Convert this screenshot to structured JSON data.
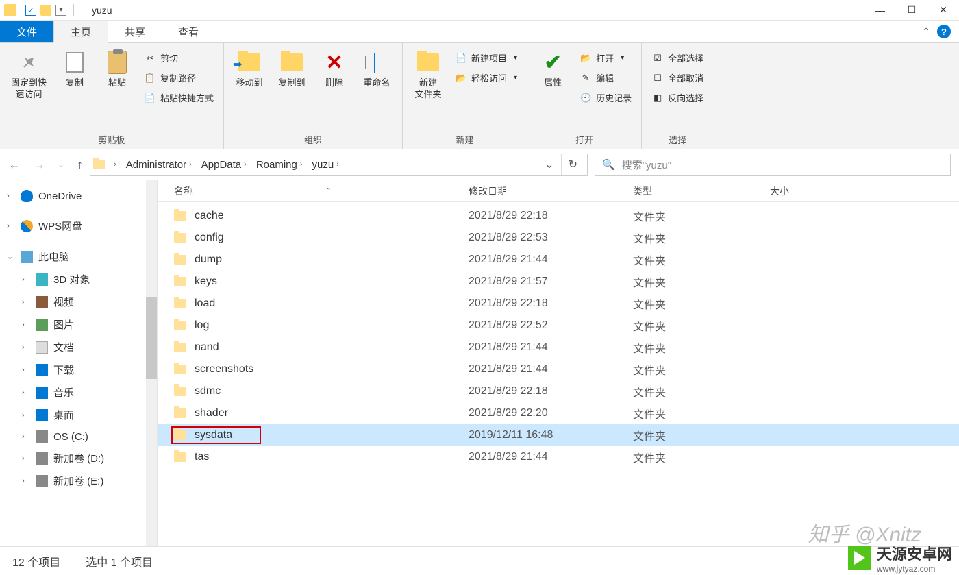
{
  "window": {
    "title": "yuzu"
  },
  "tabs": {
    "file": "文件",
    "home": "主页",
    "share": "共享",
    "view": "查看"
  },
  "ribbon": {
    "clipboard": {
      "label": "剪贴板",
      "pin": "固定到快\n速访问",
      "copy": "复制",
      "paste": "粘贴",
      "cut": "剪切",
      "copy_path": "复制路径",
      "paste_shortcut": "粘贴快捷方式"
    },
    "organize": {
      "label": "组织",
      "moveto": "移动到",
      "copyto": "复制到",
      "delete": "删除",
      "rename": "重命名"
    },
    "new": {
      "label": "新建",
      "new_folder": "新建\n文件夹",
      "new_item": "新建项目",
      "easy_access": "轻松访问"
    },
    "open": {
      "label": "打开",
      "properties": "属性",
      "open": "打开",
      "edit": "编辑",
      "history": "历史记录"
    },
    "select": {
      "label": "选择",
      "select_all": "全部选择",
      "select_none": "全部取消",
      "invert": "反向选择"
    }
  },
  "breadcrumb": [
    "Administrator",
    "AppData",
    "Roaming",
    "yuzu"
  ],
  "search": {
    "placeholder": "搜索\"yuzu\""
  },
  "navpane": [
    {
      "label": "OneDrive",
      "icon": "ico-cloud",
      "level": 1,
      "chev": "›"
    },
    {
      "label": "WPS网盘",
      "icon": "ico-wps",
      "level": 1,
      "chev": "›"
    },
    {
      "label": "此电脑",
      "icon": "ico-pc",
      "level": 1,
      "chev": "⌄"
    },
    {
      "label": "3D 对象",
      "icon": "ico-3d",
      "level": 2,
      "chev": "›"
    },
    {
      "label": "视频",
      "icon": "ico-vid",
      "level": 2,
      "chev": "›"
    },
    {
      "label": "图片",
      "icon": "ico-pic",
      "level": 2,
      "chev": "›"
    },
    {
      "label": "文档",
      "icon": "ico-doc",
      "level": 2,
      "chev": "›"
    },
    {
      "label": "下载",
      "icon": "ico-dl",
      "level": 2,
      "chev": "›"
    },
    {
      "label": "音乐",
      "icon": "ico-mus",
      "level": 2,
      "chev": "›"
    },
    {
      "label": "桌面",
      "icon": "ico-desk",
      "level": 2,
      "chev": "›"
    },
    {
      "label": "OS (C:)",
      "icon": "ico-drv",
      "level": 2,
      "chev": "›"
    },
    {
      "label": "新加卷 (D:)",
      "icon": "ico-drv",
      "level": 2,
      "chev": "›"
    },
    {
      "label": "新加卷 (E:)",
      "icon": "ico-drv",
      "level": 2,
      "chev": "›"
    }
  ],
  "columns": {
    "name": "名称",
    "date": "修改日期",
    "type": "类型",
    "size": "大小"
  },
  "files": [
    {
      "name": "cache",
      "date": "2021/8/29 22:18",
      "type": "文件夹",
      "selected": false,
      "highlight": false
    },
    {
      "name": "config",
      "date": "2021/8/29 22:53",
      "type": "文件夹",
      "selected": false,
      "highlight": false
    },
    {
      "name": "dump",
      "date": "2021/8/29 21:44",
      "type": "文件夹",
      "selected": false,
      "highlight": false
    },
    {
      "name": "keys",
      "date": "2021/8/29 21:57",
      "type": "文件夹",
      "selected": false,
      "highlight": false
    },
    {
      "name": "load",
      "date": "2021/8/29 22:18",
      "type": "文件夹",
      "selected": false,
      "highlight": false
    },
    {
      "name": "log",
      "date": "2021/8/29 22:52",
      "type": "文件夹",
      "selected": false,
      "highlight": false
    },
    {
      "name": "nand",
      "date": "2021/8/29 21:44",
      "type": "文件夹",
      "selected": false,
      "highlight": false
    },
    {
      "name": "screenshots",
      "date": "2021/8/29 21:44",
      "type": "文件夹",
      "selected": false,
      "highlight": false
    },
    {
      "name": "sdmc",
      "date": "2021/8/29 22:18",
      "type": "文件夹",
      "selected": false,
      "highlight": false
    },
    {
      "name": "shader",
      "date": "2021/8/29 22:20",
      "type": "文件夹",
      "selected": false,
      "highlight": false
    },
    {
      "name": "sysdata",
      "date": "2019/12/11 16:48",
      "type": "文件夹",
      "selected": true,
      "highlight": true
    },
    {
      "name": "tas",
      "date": "2021/8/29 21:44",
      "type": "文件夹",
      "selected": false,
      "highlight": false
    }
  ],
  "status": {
    "items": "12 个项目",
    "selected": "选中 1 个项目"
  },
  "watermark1": "知乎 @Xnitz",
  "watermark2": {
    "line1": "天源安卓网",
    "line2": "www.jytyaz.com"
  }
}
